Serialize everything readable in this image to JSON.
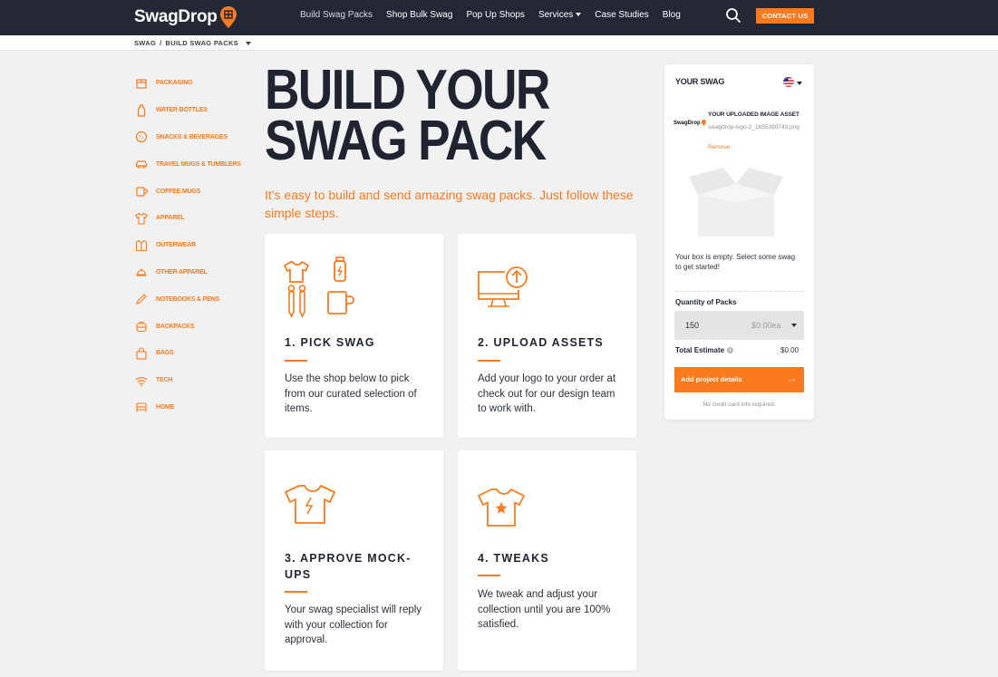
{
  "header": {
    "logo": "SwagDrop",
    "nav": [
      {
        "label": "Build Swag Packs",
        "active": true
      },
      {
        "label": "Shop Bulk Swag"
      },
      {
        "label": "Pop Up Shops"
      },
      {
        "label": "Services",
        "dropdown": true
      },
      {
        "label": "Case Studies"
      },
      {
        "label": "Blog"
      }
    ],
    "search_icon": "search-icon",
    "contact": "CONTACT US"
  },
  "breadcrumb": {
    "root": "SWAG",
    "separator": "/",
    "current": "BUILD SWAG PACKS"
  },
  "sidebar": {
    "items": [
      {
        "label": "PACKAGING",
        "icon": "box-icon"
      },
      {
        "label": "WATER BOTTLES",
        "icon": "bottle-icon"
      },
      {
        "label": "SNACKS & BEVERAGES",
        "icon": "cookie-icon"
      },
      {
        "label": "TRAVEL MUGS & TUMBLERS",
        "icon": "car-icon"
      },
      {
        "label": "COFFEE MUGS",
        "icon": "mug-icon"
      },
      {
        "label": "APPAREL",
        "icon": "tshirt-icon"
      },
      {
        "label": "OUTERWEAR",
        "icon": "jacket-icon"
      },
      {
        "label": "OTHER APPAREL",
        "icon": "hat-icon"
      },
      {
        "label": "NOTEBOOKS & PENS",
        "icon": "pen-icon"
      },
      {
        "label": "BACKPACKS",
        "icon": "backpack-icon"
      },
      {
        "label": "BAGS",
        "icon": "bag-icon"
      },
      {
        "label": "TECH",
        "icon": "wifi-icon"
      },
      {
        "label": "HOME",
        "icon": "home-icon"
      }
    ]
  },
  "hero": {
    "title_line1": "BUILD YOUR",
    "title_line2": "SWAG PACK",
    "subtitle": "It's easy to build and send amazing swag packs. Just follow these simple steps."
  },
  "steps": [
    {
      "title": "1. PICK SWAG",
      "body": "Use the shop below to pick from our curated selection of items.",
      "icon": "swag-items-icon"
    },
    {
      "title": "2. UPLOAD ASSETS",
      "body": "Add your logo to your order at check out for our design team to work with.",
      "icon": "upload-monitor-icon"
    },
    {
      "title": "3. APPROVE MOCK-UPS",
      "body": "Your swag specialist will reply with your collection for approval.",
      "icon": "tshirt-bolt-icon"
    },
    {
      "title": "4. TWEAKS",
      "body": "We tweak and adjust your collection until you are 100% satisfied.",
      "icon": "tshirt-star-icon"
    }
  ],
  "panel": {
    "title": "YOUR SWAG",
    "flag_icon": "us-flag-icon",
    "asset_logo": "SwagDrop",
    "asset_title": "YOUR UPLOADED IMAGE ASSET",
    "asset_file": "swagdrop-logo-2_1655390743.png",
    "remove": "Remove",
    "empty": "Your box is empty. Select some swag to get started!",
    "qty_label": "Quantity of Packs",
    "qty_value": "150",
    "qty_price": "$0.00ea",
    "estimate_label": "Total Estimate",
    "estimate_value": "$0.00",
    "cta": "Add project details",
    "cta_arrow": "→",
    "note": "No credit card info required."
  },
  "colors": {
    "accent": "#f97a1f",
    "dark": "#232834",
    "bg": "#f1f1f1"
  }
}
